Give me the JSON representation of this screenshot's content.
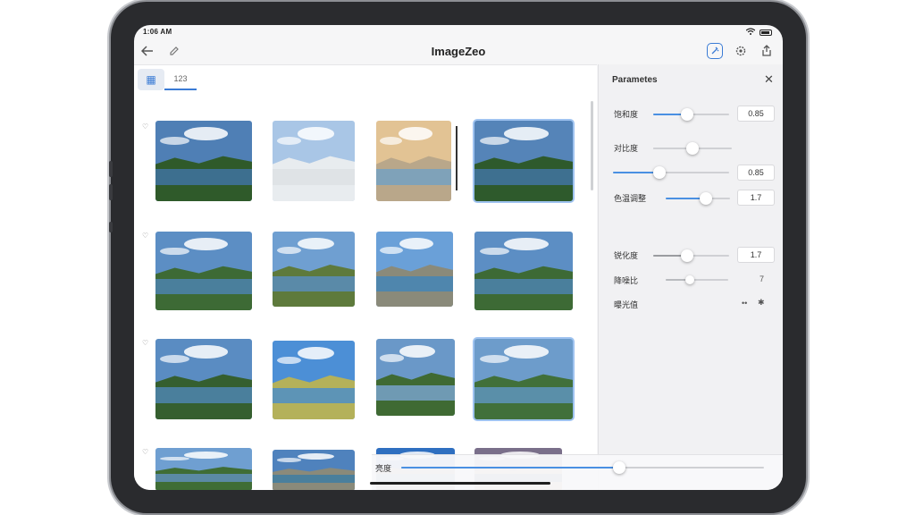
{
  "status": {
    "time": "1:06 AM",
    "battery_icon": "battery-icon",
    "wifi_icon": "wifi-icon"
  },
  "nav": {
    "title": "ImageZeo",
    "back_icon": "back-arrow-icon",
    "edit_icon": "edit-icon",
    "right_icons": [
      "magic-enhance-icon",
      "settings-gear-icon",
      "share-icon"
    ]
  },
  "tabs": [
    {
      "label": "▦",
      "icon": "grid-view-icon",
      "active": true
    },
    {
      "label": "123",
      "active": false
    }
  ],
  "row_markers": [
    "♡",
    "♡",
    "♡",
    "♡"
  ],
  "thumbnails": {
    "count": 16,
    "selected": [
      3,
      11
    ]
  },
  "panel": {
    "title": "Parametes",
    "close_label": "✕",
    "params": [
      {
        "label": "饱和度",
        "value": "0.85",
        "level": 0.45
      },
      {
        "label": "对比度",
        "value": "",
        "level": 0.5
      },
      {
        "label": "",
        "value": "0.85",
        "level": 0.45
      },
      {
        "label": "色温调整",
        "value": "1.7",
        "level": 0.45
      },
      {
        "label": "锐化度",
        "value": "1.7",
        "level": 0.42
      },
      {
        "label": "降噪比",
        "value": "7",
        "level": 0.38
      },
      {
        "label": "曝光值",
        "value": "••",
        "level": null
      }
    ]
  },
  "bottom": {
    "label": "亮度",
    "level": 0.6
  },
  "colors": {
    "accent": "#4a90e2",
    "selection": "#9fc3f0",
    "bezel": "#2a2b2e"
  }
}
